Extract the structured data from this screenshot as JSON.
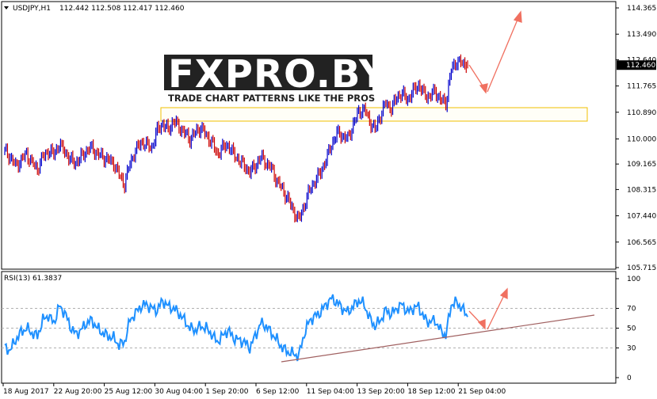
{
  "header": {
    "symbol": "USDJPY,H1",
    "quote": "112.442 112.508 112.417 112.460"
  },
  "logo": {
    "main_text": "FXPRO.BY",
    "tagline": "TRADE CHART PATTERNS LIKE THE PROS"
  },
  "rsi_header": "RSI(13) 61.3837",
  "colors": {
    "bull_bar": "#0000cc",
    "bear_bar": "#cc0000",
    "rsi_line": "#1e90ff",
    "arrow": "#f07060",
    "support_line": "#a06060",
    "highlight_box": "#f0c000",
    "price_tag_bg": "#000000"
  },
  "chart_data": [
    {
      "type": "line",
      "title": "USDJPY,H1",
      "ylim": [
        105.715,
        114.365
      ],
      "y_ticks": [
        "114.365",
        "113.490",
        "112.640",
        "111.765",
        "110.890",
        "110.000",
        "109.165",
        "108.315",
        "107.440",
        "106.565",
        "105.715"
      ],
      "current_price": "112.460",
      "grid": true,
      "x_ticks": [
        "18 Aug 2017",
        "22 Aug 20:00",
        "25 Aug 12:00",
        "30 Aug 04:00",
        "1 Sep 20:00",
        "6 Sep 12:00",
        "11 Sep 04:00",
        "13 Sep 20:00",
        "18 Sep 12:00",
        "21 Sep 04:00"
      ],
      "series": [
        {
          "values": [
            109.6,
            109.4,
            109.1,
            109.3,
            109.5,
            109.2,
            109.0,
            109.4,
            109.6,
            109.5,
            109.8,
            109.6,
            109.3,
            109.2,
            109.4,
            109.6,
            109.7,
            109.5,
            109.4,
            109.3,
            109.2,
            108.8,
            108.5,
            109.2,
            109.6,
            109.9,
            109.8,
            109.7,
            110.3,
            110.5,
            110.3,
            110.6,
            110.4,
            110.2,
            110.0,
            110.2,
            110.4,
            110.1,
            109.9,
            109.5,
            109.7,
            109.8,
            109.5,
            109.3,
            109.1,
            108.9,
            109.1,
            109.4,
            109.2,
            109.0,
            108.6,
            108.3,
            108.0,
            107.6,
            107.3,
            107.8,
            108.3,
            108.6,
            108.9,
            109.3,
            109.8,
            110.2,
            110.1,
            110.0,
            110.5,
            110.9,
            111.0,
            110.6,
            110.3,
            110.8,
            111.2,
            111.0,
            111.4,
            111.5,
            111.3,
            111.6,
            111.8,
            111.5,
            111.4,
            111.6,
            111.3,
            111.2,
            112.3,
            112.6,
            112.5,
            112.46
          ]
        }
      ]
    },
    {
      "type": "line",
      "title": "RSI(13) 61.3837",
      "ylim": [
        0,
        100
      ],
      "y_ticks": [
        "100",
        "70",
        "50",
        "30",
        "0"
      ],
      "grid": true,
      "series": [
        {
          "values": [
            30,
            28,
            38,
            46,
            50,
            45,
            42,
            58,
            63,
            55,
            72,
            66,
            52,
            44,
            48,
            55,
            58,
            50,
            45,
            42,
            40,
            33,
            36,
            58,
            65,
            72,
            74,
            70,
            68,
            78,
            72,
            70,
            65,
            58,
            50,
            48,
            52,
            50,
            44,
            36,
            42,
            48,
            40,
            38,
            36,
            30,
            42,
            55,
            52,
            45,
            38,
            30,
            26,
            24,
            22,
            44,
            58,
            62,
            66,
            74,
            80,
            76,
            70,
            66,
            72,
            78,
            74,
            60,
            52,
            58,
            68,
            64,
            70,
            74,
            66,
            70,
            72,
            60,
            56,
            58,
            48,
            42,
            74,
            76,
            70,
            61.38
          ]
        }
      ]
    }
  ]
}
